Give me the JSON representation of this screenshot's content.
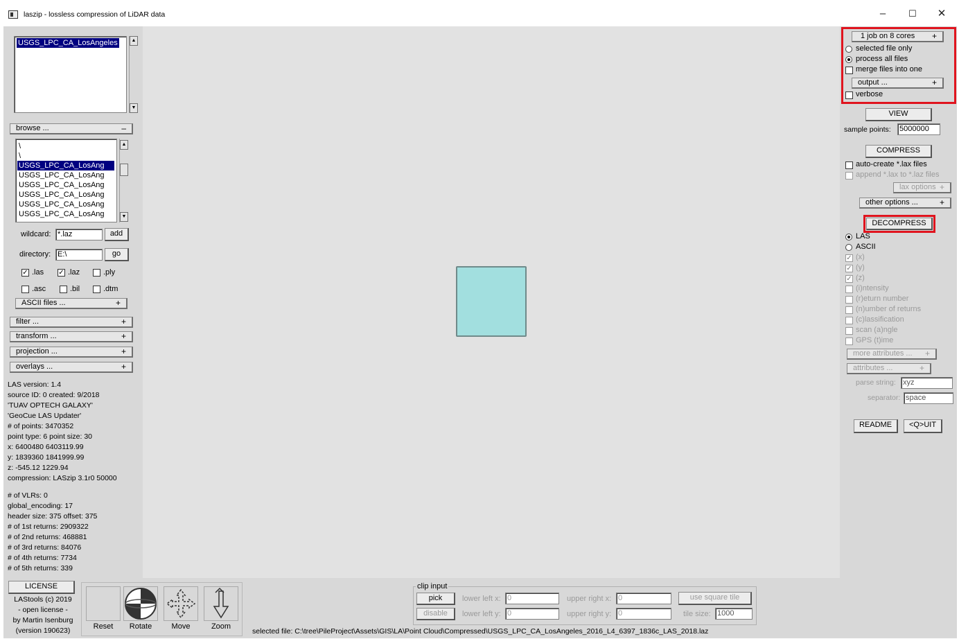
{
  "window": {
    "title": "laszip - lossless compression of LiDAR data",
    "minimize": "–",
    "maximize": "☐",
    "close": "✕"
  },
  "left": {
    "top_list": [
      "USGS_LPC_CA_LosAngeles"
    ],
    "browse_label": "browse ...",
    "browse_sign": "–",
    "file_list": [
      "\\",
      "\\",
      "USGS_LPC_CA_LosAng",
      "USGS_LPC_CA_LosAng",
      "USGS_LPC_CA_LosAng",
      "USGS_LPC_CA_LosAng",
      "USGS_LPC_CA_LosAng",
      "USGS_LPC_CA_LosAng"
    ],
    "wildcard_label": "wildcard:",
    "wildcard_value": "*.laz",
    "add_label": "add",
    "directory_label": "directory:",
    "directory_value": "E:\\",
    "go_label": "go",
    "ext": {
      "las": ".las",
      "laz": ".laz",
      "ply": ".ply",
      "asc": ".asc",
      "bil": ".bil",
      "dtm": ".dtm"
    },
    "ascii_files": "ASCII files ...",
    "filter": "filter ...",
    "transform": "transform ...",
    "projection": "projection ...",
    "overlays": "overlays ...",
    "plus": "+",
    "info_lines": [
      "LAS version: 1.4",
      "source ID:      0 created: 9/2018",
      "'TUAV OPTECH GALAXY'",
      "'GeoCue LAS Updater'",
      "# of points: 3470352",
      "point type: 6 point size: 30",
      "x: 6400480 6403119.99",
      "y: 1839360 1841999.99",
      "z: -545.12 1229.94",
      "compression: LASzip 3.1r0 50000"
    ],
    "info_lines2": [
      "# of VLRs: 0",
      "global_encoding: 17",
      "header size: 375 offset: 375",
      "# of 1st returns: 2909322",
      "# of 2nd returns: 468881",
      "# of 3rd returns: 84076",
      "# of 4th returns: 7734",
      "# of 5th returns: 339"
    ]
  },
  "right": {
    "jobs": "1 job on 8 cores",
    "selected_only": "selected file only",
    "process_all": "process all files",
    "merge": "merge files into one",
    "output": "output ...",
    "verbose": "verbose",
    "view": "VIEW",
    "sample_points_label": "sample points:",
    "sample_points_value": "5000000",
    "compress": "COMPRESS",
    "auto_create": "auto-create *.lax files",
    "append": "append *.lax to *.laz files",
    "lax_options": "lax options",
    "other_options": "other options ...",
    "decompress": "DECOMPRESS",
    "fmt_las": "LAS",
    "fmt_ascii": "ASCII",
    "attrs": [
      "(x)",
      "(y)",
      "(z)",
      "(i)ntensity",
      "(r)eturn number",
      "(n)umber of returns",
      "(c)lassification",
      "scan (a)ngle",
      "GPS (t)ime"
    ],
    "more_attributes": "more attributes ...",
    "attributes": "attributes ...",
    "parse_string_label": "parse string:",
    "parse_string_value": "xyz",
    "separator_label": "separator:",
    "separator_value": "space",
    "readme": "README",
    "quit": "<Q>UIT"
  },
  "bottom": {
    "license": "LICENSE",
    "credits": [
      "LAStools (c) 2019",
      "- open license -",
      "by Martin Isenburg",
      "(version 190623)"
    ],
    "tools": [
      "Reset",
      "Rotate",
      "Move",
      "Zoom"
    ],
    "clip_input": "clip input",
    "pick": "pick",
    "disable": "disable",
    "lower_left_x_label": "lower left x:",
    "lower_left_y_label": "lower left y:",
    "upper_right_x_label": "upper right x:",
    "upper_right_y_label": "upper right y:",
    "lower_left_x": "0",
    "lower_left_y": "0",
    "upper_right_x": "0",
    "upper_right_y": "0",
    "use_square_tile": "use square tile",
    "tile_size_label": "tile size:",
    "tile_size_value": "1000",
    "selected_file": "selected file: C:\\tree\\PileProject\\Assets\\GIS\\LA\\Point Cloud\\Compressed\\USGS_LPC_CA_LosAngeles_2016_L4_6397_1836c_LAS_2018.laz"
  }
}
